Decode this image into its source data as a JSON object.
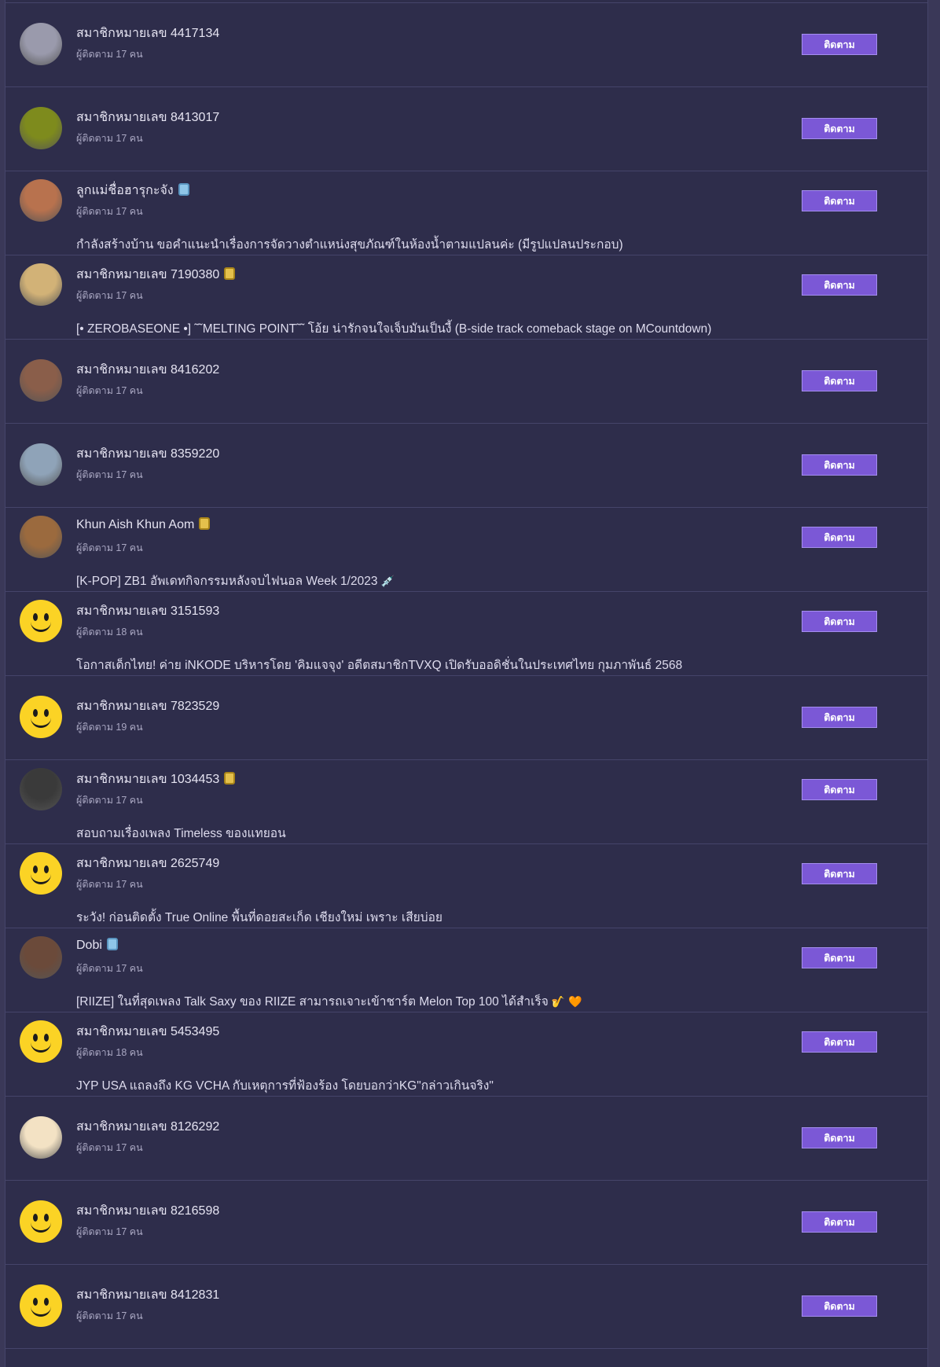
{
  "follow_label": "ติดตาม",
  "members": [
    {
      "name": "สมาชิกหมายเลข 4417134",
      "badge": "",
      "followers": "ผู้ติดตาม 17 คน",
      "topic": "",
      "avatar": "photo",
      "avatar_color": "#9a9aac"
    },
    {
      "name": "สมาชิกหมายเลข 8413017",
      "badge": "",
      "followers": "ผู้ติดตาม 17 คน",
      "topic": "",
      "avatar": "photo",
      "avatar_color": "#7e8b1d"
    },
    {
      "name": "ลูกแม่ชื่อฮารุกะจัง",
      "badge": "blue",
      "followers": "ผู้ติดตาม 17 คน",
      "topic": "กำลังสร้างบ้าน ขอคำแนะนำเรื่องการจัดวางตำแหน่งสุขภัณฑ์ในห้องน้ำตามแปลนค่ะ (มีรูปแปลนประกอบ)",
      "avatar": "photo",
      "avatar_color": "#b8724e"
    },
    {
      "name": "สมาชิกหมายเลข 7190380",
      "badge": "gold",
      "followers": "ผู้ติดตาม 17 คน",
      "topic": "[• ZEROBASEONE •] ˜˜MELTING POINT˜˜ โอ้ย น่ารักจนใจเจ็บมันเป็นงี้ (B-side track comeback stage on MCountdown)",
      "avatar": "photo",
      "avatar_color": "#d2b277"
    },
    {
      "name": "สมาชิกหมายเลข 8416202",
      "badge": "",
      "followers": "ผู้ติดตาม 17 คน",
      "topic": "",
      "avatar": "photo",
      "avatar_color": "#8a5e4a"
    },
    {
      "name": "สมาชิกหมายเลข 8359220",
      "badge": "",
      "followers": "ผู้ติดตาม 17 คน",
      "topic": "",
      "avatar": "photo",
      "avatar_color": "#8fa3b8"
    },
    {
      "name": "Khun Aish Khun Aom",
      "badge": "gold",
      "followers": "ผู้ติดตาม 17 คน",
      "topic": "[K-POP] ZB1 อัพเดทกิจกรรมหลังจบไฟนอล Week 1/2023",
      "topic_emoji": "💉",
      "avatar": "photo",
      "avatar_color": "#9b6a3e"
    },
    {
      "name": "สมาชิกหมายเลข 3151593",
      "badge": "",
      "followers": "ผู้ติดตาม 18 คน",
      "topic": "โอกาสเด็กไทย! ค่าย iNKODE บริหารโดย 'คิมแจจุง' อดีตสมาชิกTVXQ เปิดรับออดิชั่นในประเทศไทย กุมภาพันธ์ 2568",
      "avatar": "smile",
      "avatar_color": "#fbd325"
    },
    {
      "name": "สมาชิกหมายเลข 7823529",
      "badge": "",
      "followers": "ผู้ติดตาม 19 คน",
      "topic": "",
      "avatar": "smile",
      "avatar_color": "#fbd325"
    },
    {
      "name": "สมาชิกหมายเลข 1034453",
      "badge": "gold",
      "followers": "ผู้ติดตาม 17 คน",
      "topic": "สอบถามเรื่องเพลง Timeless ของแทยอน",
      "avatar": "photo",
      "avatar_color": "#3a3a3a"
    },
    {
      "name": "สมาชิกหมายเลข 2625749",
      "badge": "",
      "followers": "ผู้ติดตาม 17 คน",
      "topic": "ระวัง! ก่อนติดตั้ง True Online พื้นที่ดอยสะเก็ด เชียงใหม่ เพราะ เสียบ่อย",
      "avatar": "smile",
      "avatar_color": "#fbd325"
    },
    {
      "name": "Dobi",
      "badge": "blue",
      "followers": "ผู้ติดตาม 17 คน",
      "topic": "[RIIZE] ในที่สุดเพลง Talk Saxy ของ RIIZE สามารถเจาะเข้าชาร์ต Melon Top 100 ได้สำเร็จ",
      "topic_emoji": "🎷 🧡",
      "avatar": "photo",
      "avatar_color": "#6b4a3a"
    },
    {
      "name": "สมาชิกหมายเลข 5453495",
      "badge": "",
      "followers": "ผู้ติดตาม 18 คน",
      "topic": "JYP USA แถลงถึง KG VCHA กับเหตุการที่ฟ้องร้อง โดยบอกว่าKG\"กล่าวเกินจริง\"",
      "avatar": "smile",
      "avatar_color": "#fbd325"
    },
    {
      "name": "สมาชิกหมายเลข 8126292",
      "badge": "",
      "followers": "ผู้ติดตาม 17 คน",
      "topic": "",
      "avatar": "photo",
      "avatar_color": "#f3e2c4"
    },
    {
      "name": "สมาชิกหมายเลข 8216598",
      "badge": "",
      "followers": "ผู้ติดตาม 17 คน",
      "topic": "",
      "avatar": "smile",
      "avatar_color": "#fbd325"
    },
    {
      "name": "สมาชิกหมายเลข 8412831",
      "badge": "",
      "followers": "ผู้ติดตาม 17 คน",
      "topic": "",
      "avatar": "smile",
      "avatar_color": "#fbd325"
    }
  ]
}
